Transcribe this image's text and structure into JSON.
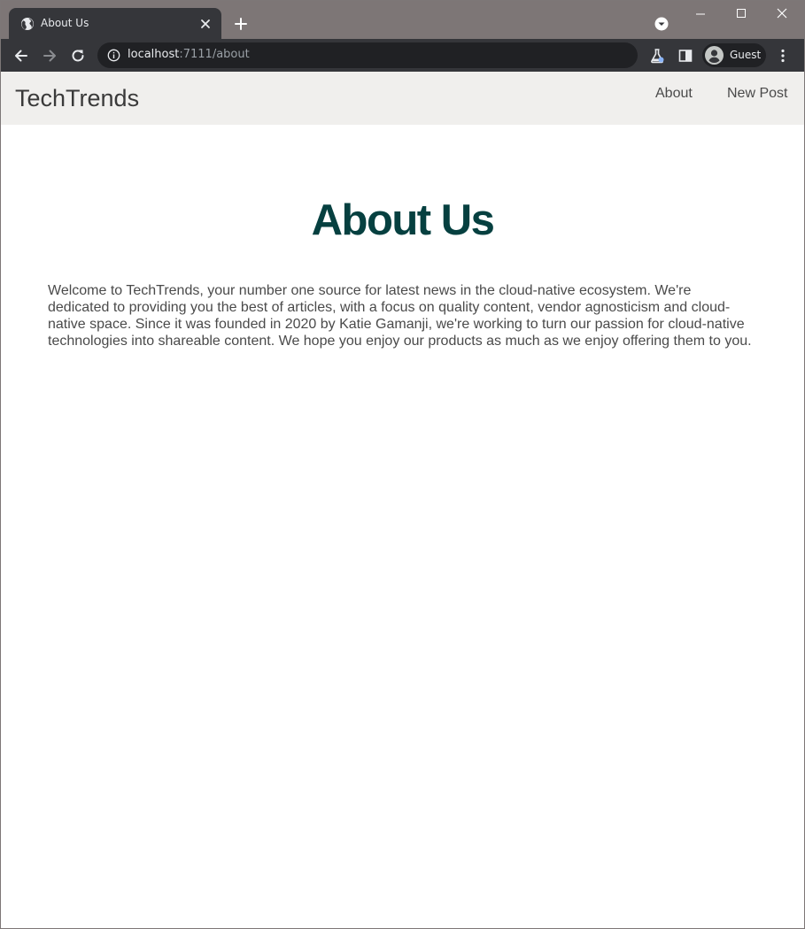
{
  "browser": {
    "tab": {
      "title": "About Us",
      "favicon": "globe-icon",
      "close_icon": "close-icon"
    },
    "new_tab_icon": "plus-icon",
    "tab_search_icon": "chevron-down-circle-icon",
    "window_controls": [
      "minimize-icon",
      "maximize-icon",
      "close-icon"
    ],
    "toolbar": {
      "back_icon": "arrow-left-icon",
      "forward_icon": "arrow-right-icon",
      "reload_icon": "reload-icon",
      "url_host": "localhost",
      "url_rest": ":7111/about",
      "extensions_icon": "flask-icon",
      "side_panel_icon": "side-panel-icon",
      "profile_label": "Guest",
      "menu_icon": "kebab-menu-icon"
    },
    "colors": {
      "titlebar": "#7d7676",
      "toolbar": "#35363a",
      "omnibox": "#202124"
    }
  },
  "site": {
    "brand": "TechTrends",
    "nav": [
      {
        "label": "About"
      },
      {
        "label": "New Post"
      }
    ],
    "colors": {
      "navbar_bg": "#f0efed",
      "heading": "#064040",
      "text": "#4a4a4a"
    }
  },
  "main": {
    "title": "About Us",
    "paragraph": "Welcome to TechTrends, your number one source for latest news in the cloud-native ecosystem. We're dedicated to providing you the best of articles, with a focus on quality content, vendor agnosticism and cloud-native space. Since it was founded in 2020 by Katie Gamanji, we're working to turn our passion for cloud-native technologies into shareable content. We hope you enjoy our products as much as we enjoy offering them to you."
  }
}
